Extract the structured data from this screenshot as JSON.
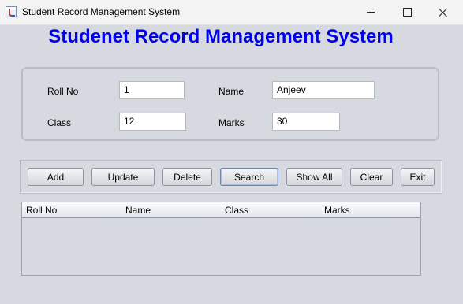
{
  "window": {
    "title": "Student Record Management System"
  },
  "heading": "Studenet Record Management System",
  "form": {
    "roll_no": {
      "label": "Roll No",
      "value": "1"
    },
    "name": {
      "label": "Name",
      "value": "Anjeev"
    },
    "class": {
      "label": "Class",
      "value": "12"
    },
    "marks": {
      "label": "Marks",
      "value": "30"
    }
  },
  "buttons": {
    "add": "Add",
    "update": "Update",
    "delete": "Delete",
    "search": "Search",
    "show_all": "Show All",
    "clear": "Clear",
    "exit": "Exit"
  },
  "table": {
    "columns": [
      "Roll No",
      "Name",
      "Class",
      "Marks"
    ],
    "rows": []
  },
  "colors": {
    "heading": "#0000ee",
    "background": "#d6d9df"
  },
  "icons": [
    "java-app-icon",
    "minimize-icon",
    "maximize-icon",
    "close-icon"
  ]
}
